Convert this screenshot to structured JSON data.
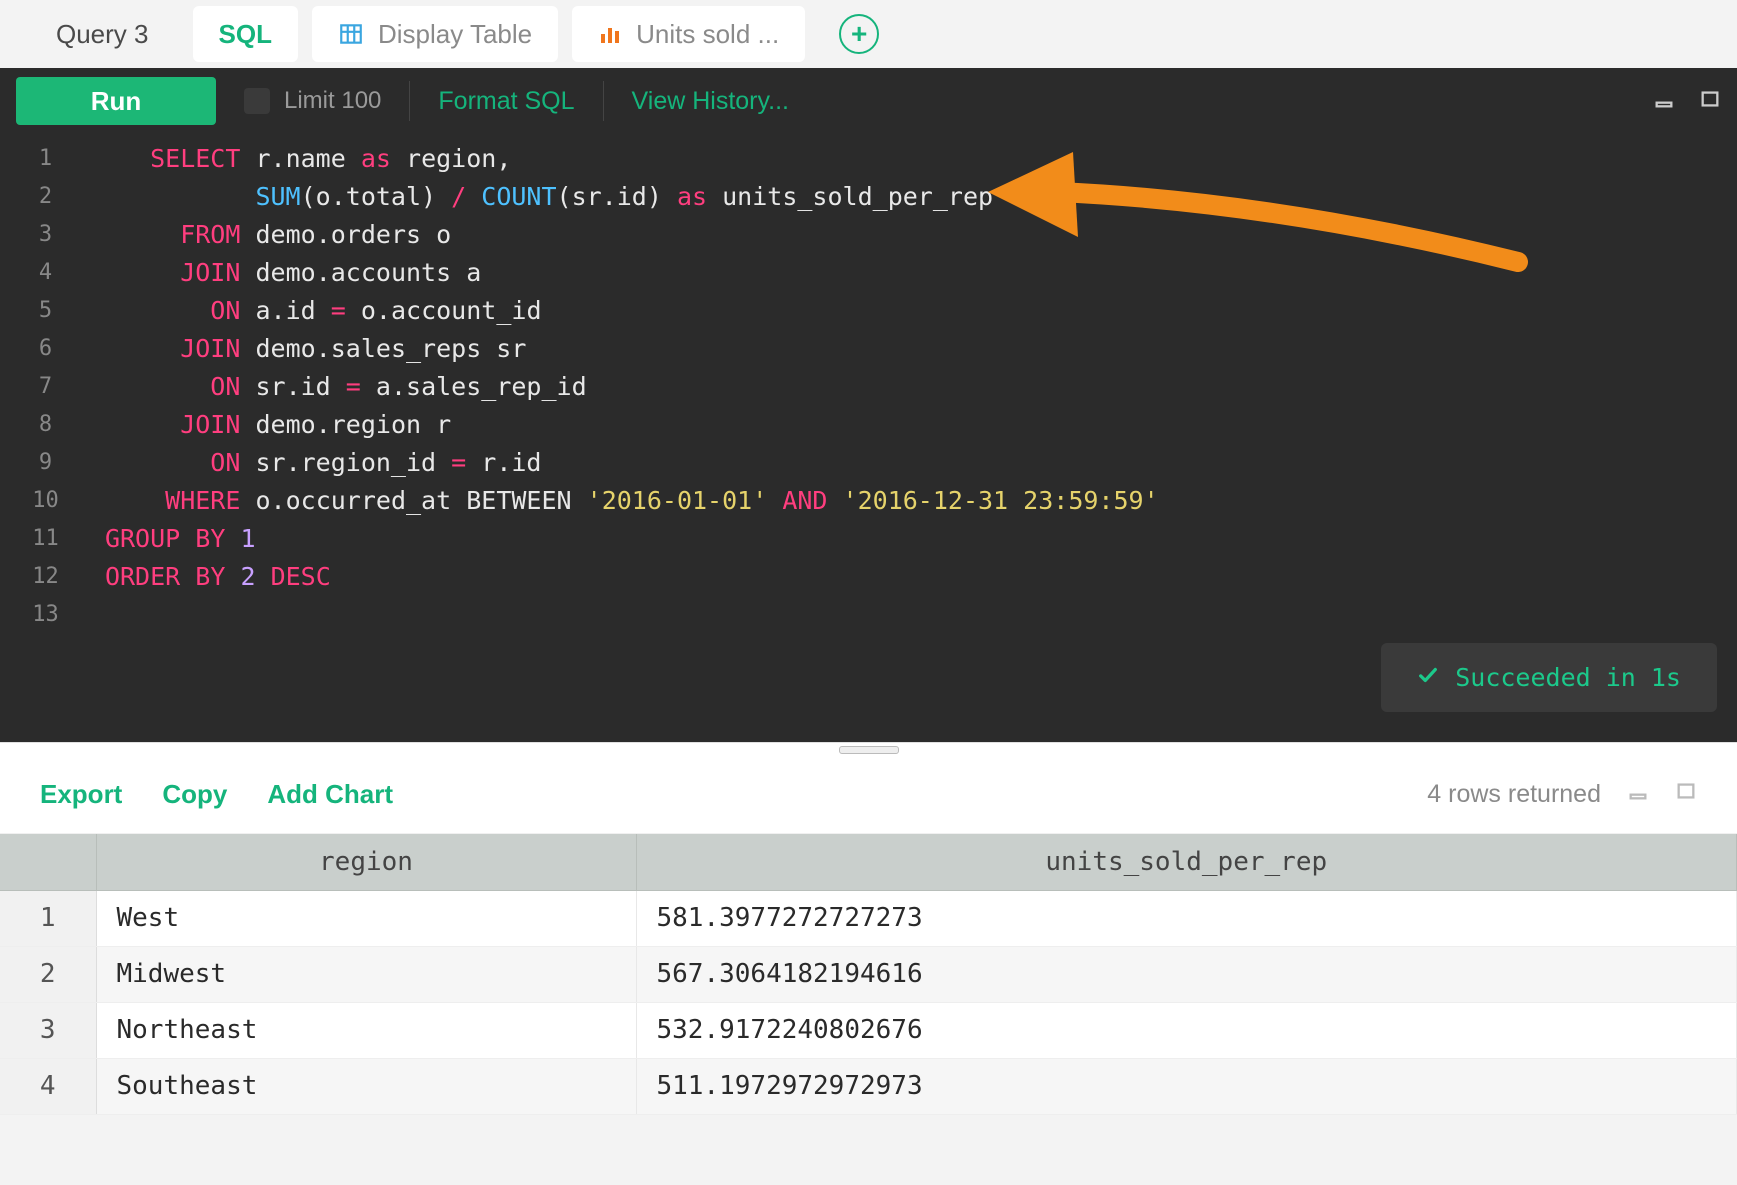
{
  "query_label": "Query 3",
  "tabs": [
    {
      "label": "SQL",
      "active": true,
      "icon": "sql"
    },
    {
      "label": "Display Table",
      "active": false,
      "icon": "table"
    },
    {
      "label": "Units sold ...",
      "active": false,
      "icon": "chart"
    }
  ],
  "toolbar": {
    "run_label": "Run",
    "limit_label": "Limit 100",
    "format_label": "Format SQL",
    "history_label": "View History..."
  },
  "code": {
    "lines": [
      {
        "n": 1,
        "tokens": [
          [
            "pad",
            "   "
          ],
          [
            "kw",
            "SELECT"
          ],
          [
            "sp",
            " "
          ],
          [
            "ident",
            "r.name"
          ],
          [
            "sp",
            " "
          ],
          [
            "kw",
            "as"
          ],
          [
            "sp",
            " "
          ],
          [
            "ident",
            "region,"
          ]
        ]
      },
      {
        "n": 2,
        "tokens": [
          [
            "pad",
            "          "
          ],
          [
            "func",
            "SUM"
          ],
          [
            "ident",
            "(o.total)"
          ],
          [
            "sp",
            " "
          ],
          [
            "op",
            "/"
          ],
          [
            "sp",
            " "
          ],
          [
            "func",
            "COUNT"
          ],
          [
            "ident",
            "(sr.id)"
          ],
          [
            "sp",
            " "
          ],
          [
            "kw",
            "as"
          ],
          [
            "sp",
            " "
          ],
          [
            "ident",
            "units_sold_per_rep"
          ]
        ]
      },
      {
        "n": 3,
        "tokens": [
          [
            "pad",
            "     "
          ],
          [
            "kw",
            "FROM"
          ],
          [
            "sp",
            " "
          ],
          [
            "ident",
            "demo.orders o"
          ]
        ]
      },
      {
        "n": 4,
        "tokens": [
          [
            "pad",
            "     "
          ],
          [
            "kw",
            "JOIN"
          ],
          [
            "sp",
            " "
          ],
          [
            "ident",
            "demo.accounts a"
          ]
        ]
      },
      {
        "n": 5,
        "tokens": [
          [
            "pad",
            "       "
          ],
          [
            "kw",
            "ON"
          ],
          [
            "sp",
            " "
          ],
          [
            "ident",
            "a.id"
          ],
          [
            "sp",
            " "
          ],
          [
            "op",
            "="
          ],
          [
            "sp",
            " "
          ],
          [
            "ident",
            "o.account_id"
          ]
        ]
      },
      {
        "n": 6,
        "tokens": [
          [
            "pad",
            "     "
          ],
          [
            "kw",
            "JOIN"
          ],
          [
            "sp",
            " "
          ],
          [
            "ident",
            "demo.sales_reps sr"
          ]
        ]
      },
      {
        "n": 7,
        "tokens": [
          [
            "pad",
            "       "
          ],
          [
            "kw",
            "ON"
          ],
          [
            "sp",
            " "
          ],
          [
            "ident",
            "sr.id"
          ],
          [
            "sp",
            " "
          ],
          [
            "op",
            "="
          ],
          [
            "sp",
            " "
          ],
          [
            "ident",
            "a.sales_rep_id"
          ]
        ]
      },
      {
        "n": 8,
        "tokens": [
          [
            "pad",
            "     "
          ],
          [
            "kw",
            "JOIN"
          ],
          [
            "sp",
            " "
          ],
          [
            "ident",
            "demo.region r"
          ]
        ]
      },
      {
        "n": 9,
        "tokens": [
          [
            "pad",
            "       "
          ],
          [
            "kw",
            "ON"
          ],
          [
            "sp",
            " "
          ],
          [
            "ident",
            "sr.region_id"
          ],
          [
            "sp",
            " "
          ],
          [
            "op",
            "="
          ],
          [
            "sp",
            " "
          ],
          [
            "ident",
            "r.id"
          ]
        ]
      },
      {
        "n": 10,
        "tokens": [
          [
            "pad",
            "    "
          ],
          [
            "kw",
            "WHERE"
          ],
          [
            "sp",
            " "
          ],
          [
            "ident",
            "o.occurred_at"
          ],
          [
            "sp",
            " "
          ],
          [
            "ident",
            "BETWEEN"
          ],
          [
            "sp",
            " "
          ],
          [
            "str",
            "'2016-01-01'"
          ],
          [
            "sp",
            " "
          ],
          [
            "and",
            "AND"
          ],
          [
            "sp",
            " "
          ],
          [
            "str",
            "'2016-12-31 23:59:59'"
          ]
        ]
      },
      {
        "n": 11,
        "tokens": [
          [
            "kw",
            "GROUP"
          ],
          [
            "sp",
            " "
          ],
          [
            "kw",
            "BY"
          ],
          [
            "sp",
            " "
          ],
          [
            "num",
            "1"
          ]
        ]
      },
      {
        "n": 12,
        "tokens": [
          [
            "kw",
            "ORDER"
          ],
          [
            "sp",
            " "
          ],
          [
            "kw",
            "BY"
          ],
          [
            "sp",
            " "
          ],
          [
            "num",
            "2"
          ],
          [
            "sp",
            " "
          ],
          [
            "desc",
            "DESC"
          ]
        ]
      },
      {
        "n": 13,
        "tokens": []
      }
    ]
  },
  "status": {
    "text": "Succeeded in 1s"
  },
  "results_toolbar": {
    "export_label": "Export",
    "copy_label": "Copy",
    "addchart_label": "Add Chart",
    "rows_returned": "4 rows returned"
  },
  "results": {
    "columns": [
      "region",
      "units_sold_per_rep"
    ],
    "rows": [
      {
        "n": 1,
        "region": "West",
        "units_sold_per_rep": "581.3977272727273"
      },
      {
        "n": 2,
        "region": "Midwest",
        "units_sold_per_rep": "567.3064182194616"
      },
      {
        "n": 3,
        "region": "Northeast",
        "units_sold_per_rep": "532.9172240802676"
      },
      {
        "n": 4,
        "region": "Southeast",
        "units_sold_per_rep": "511.1972972972973"
      }
    ]
  },
  "colors": {
    "accent": "#15b47c",
    "run": "#1cb776",
    "editor_bg": "#2b2b2b",
    "keyword": "#ff3e7f",
    "function": "#4ec1ff",
    "string": "#e6d36b",
    "number": "#c8a0ff",
    "annotation_arrow": "#f28c1a"
  }
}
